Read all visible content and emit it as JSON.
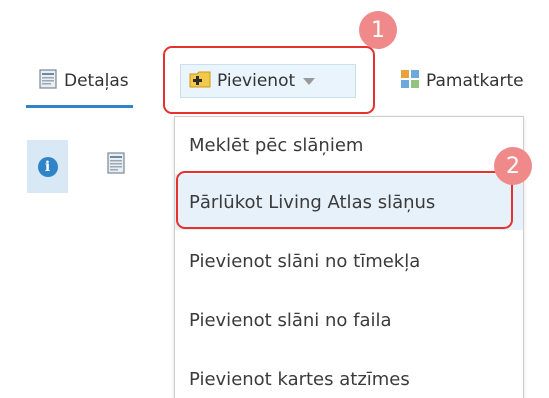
{
  "toolbar": {
    "details_label": "Detaļas",
    "add_label": "Pievienot",
    "basemap_label": "Pamatkarte"
  },
  "dropdown": {
    "items": [
      {
        "label": "Meklēt pēc slāņiem"
      },
      {
        "label": "Pārlūkot Living Atlas slāņus"
      },
      {
        "label": "Pievienot slāni no tīmekļa"
      },
      {
        "label": "Pievienot slāni no faila"
      },
      {
        "label": "Pievienot kartes atzīmes"
      }
    ]
  },
  "callouts": {
    "step1": "1",
    "step2": "2"
  },
  "colors": {
    "accent": "#2f84c9",
    "callout_border": "#e8312f",
    "badge": "#f08a8a",
    "active_bg": "#d8e8f5"
  },
  "icons": {
    "details": "details-document-icon",
    "add": "add-plus-icon",
    "basemap": "basemap-grid-icon",
    "info": "info-icon",
    "legend": "legend-document-icon"
  }
}
